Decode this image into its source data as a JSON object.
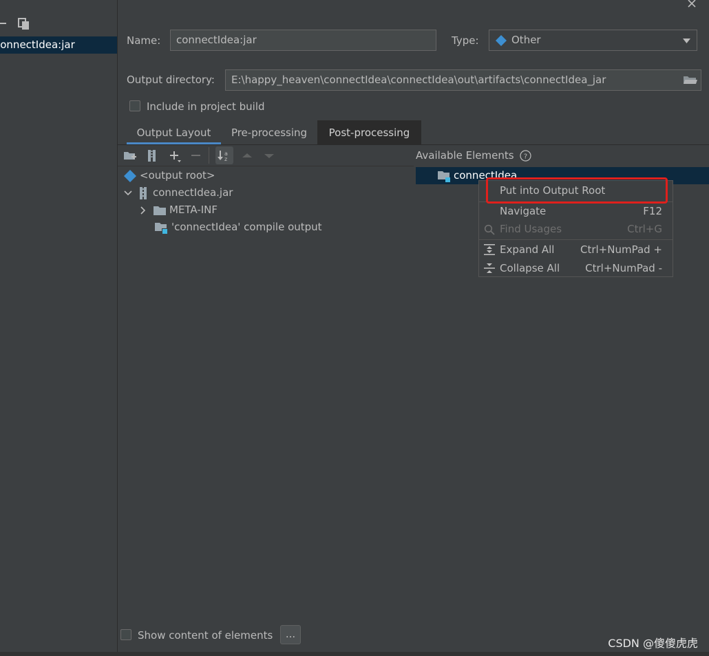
{
  "sidebar": {
    "artifact_item": "connectIdea:jar"
  },
  "form": {
    "name_label": "Name:",
    "name_value": "connectIdea:jar",
    "type_label": "Type:",
    "type_value": "Other",
    "output_dir_label": "Output directory:",
    "output_dir_value": "E:\\happy_heaven\\connectIdea\\connectIdea\\out\\artifacts\\connectIdea_jar",
    "include_label": "Include in project build",
    "include_checked": false
  },
  "tabs": [
    {
      "label": "Output Layout",
      "active": false
    },
    {
      "label": "Pre-processing",
      "active": false
    },
    {
      "label": "Post-processing",
      "active": true
    }
  ],
  "tree": {
    "root": "<output root>",
    "jar": "connectIdea.jar",
    "meta_inf": "META-INF",
    "compile_output": "'connectIdea' compile output"
  },
  "available": {
    "title": "Available Elements",
    "item": "connectIdea"
  },
  "context_menu": {
    "items": [
      {
        "label": "Put into Output Root",
        "shortcut": "",
        "disabled": false
      },
      {
        "label": "Navigate",
        "shortcut": "F12",
        "disabled": false
      },
      {
        "label": "Find Usages",
        "shortcut": "Ctrl+G",
        "disabled": true
      },
      {
        "label": "Expand All",
        "shortcut": "Ctrl+NumPad +",
        "disabled": false
      },
      {
        "label": "Collapse All",
        "shortcut": "Ctrl+NumPad -",
        "disabled": false
      }
    ]
  },
  "footer": {
    "show_content_label": "Show content of elements",
    "more_button": "..."
  },
  "watermark": "CSDN @傻傻虎虎",
  "colors": {
    "background": "#3c3f41",
    "selection": "#0d293e",
    "highlight_box": "#e0201c",
    "tab_underline": "#4a88c7"
  }
}
